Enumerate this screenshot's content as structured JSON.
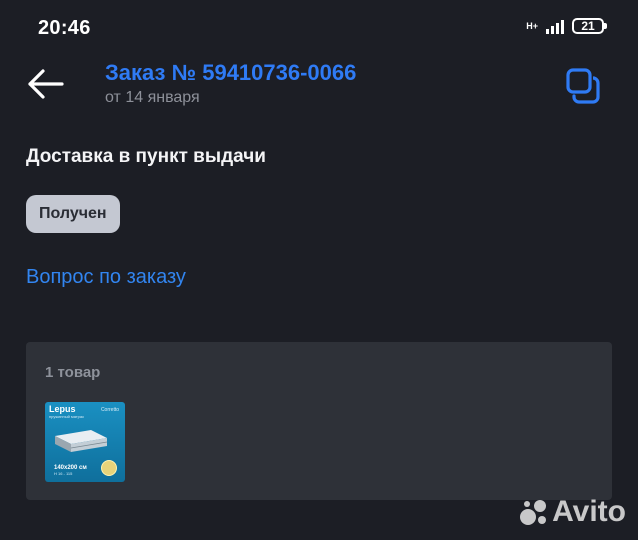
{
  "status_bar": {
    "time": "20:46",
    "network_type": "H+",
    "signal_bars": 4,
    "battery_level": "21"
  },
  "header": {
    "back_icon": "arrow-left-icon",
    "title": "Заказ № 59410736-0066",
    "subtitle": "от 14 января",
    "copy_icon": "copy-icon"
  },
  "order": {
    "delivery_type": "Доставка в пункт выдачи",
    "status": "Получен",
    "question_link": "Вопрос по заказу"
  },
  "items_card": {
    "count_label": "1 товар",
    "product": {
      "image_icon": "mattress-product-image",
      "brand": "Lepus",
      "subtitle": "пружинный матрас",
      "series": "Corretto",
      "size": "140x200 см",
      "size_note": "H 16 - 115"
    }
  },
  "watermark": {
    "text": "Avito"
  },
  "colors": {
    "background": "#1c1e25",
    "accent": "#2f7bf5",
    "card": "#2e3138",
    "badge": "#c4c8d2",
    "muted_text": "#8d9099"
  }
}
